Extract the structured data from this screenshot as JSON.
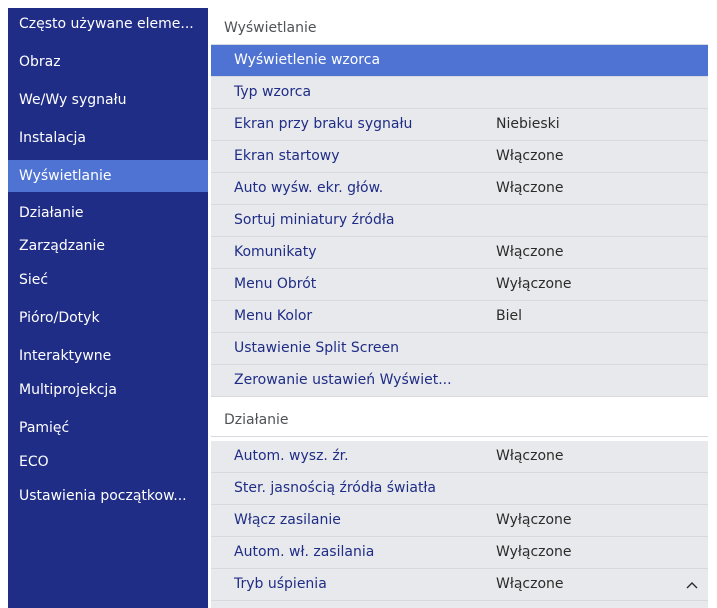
{
  "sidebar": {
    "items": [
      {
        "label": "Często używane eleme..."
      },
      {
        "label": "Obraz"
      },
      {
        "label": "We/Wy sygnału"
      },
      {
        "label": "Instalacja"
      },
      {
        "label": "Wyświetlanie",
        "selected": true
      },
      {
        "label": "Działanie"
      },
      {
        "label": "Zarządzanie"
      },
      {
        "label": "Sieć"
      },
      {
        "label": "Pióro/Dotyk"
      },
      {
        "label": "Interaktywne"
      },
      {
        "label": "Multiprojekcja"
      },
      {
        "label": "Pamięć"
      },
      {
        "label": "ECO"
      },
      {
        "label": "Ustawienia początkow..."
      }
    ]
  },
  "main": {
    "sections": [
      {
        "header": "Wyświetlanie",
        "items": [
          {
            "label": "Wyświetlenie wzorca",
            "value": "",
            "selected": true
          },
          {
            "label": "Typ wzorca",
            "value": ""
          },
          {
            "label": "Ekran przy braku sygnału",
            "value": "Niebieski"
          },
          {
            "label": "Ekran startowy",
            "value": "Włączone"
          },
          {
            "label": "Auto wyśw. ekr. głów.",
            "value": "Włączone"
          },
          {
            "label": "Sortuj miniatury źródła",
            "value": ""
          },
          {
            "label": "Komunikaty",
            "value": "Włączone"
          },
          {
            "label": "Menu Obrót",
            "value": "Wyłączone"
          },
          {
            "label": "Menu Kolor",
            "value": "Biel"
          },
          {
            "label": "Ustawienie Split Screen",
            "value": ""
          },
          {
            "label": "Zerowanie ustawień Wyświet...",
            "value": ""
          }
        ]
      },
      {
        "header": "Działanie",
        "items": [
          {
            "label": "Autom. wysz. źr.",
            "value": "Włączone"
          },
          {
            "label": "Ster. jasnością źródła światła",
            "value": ""
          },
          {
            "label": "Włącz zasilanie",
            "value": "Wyłączone"
          },
          {
            "label": "Autom. wł. zasilania",
            "value": "Wyłączone"
          },
          {
            "label": "Tryb uśpienia",
            "value": "Włączone"
          }
        ]
      }
    ]
  },
  "icons": {
    "scroll_up": "chevron-up-icon"
  },
  "colors": {
    "sidebar_bg": "#1f2d86",
    "selected_bg": "#4f73d2",
    "item_bg": "#e8e9ec",
    "item_text": "#1f2d86",
    "value_text": "#2b2b2b"
  }
}
